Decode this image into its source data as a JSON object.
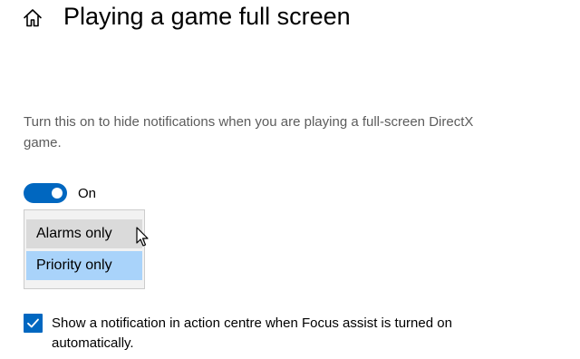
{
  "header": {
    "icon": "home-icon",
    "title": "Playing a game full screen"
  },
  "description": "Turn this on to hide notifications when you are playing a full-screen DirectX game.",
  "toggle": {
    "state": "on",
    "label": "On",
    "accent_color": "#0067c0"
  },
  "dropdown": {
    "options": [
      {
        "label": "Alarms only",
        "state": "hovered"
      },
      {
        "label": "Priority only",
        "state": "selected"
      }
    ],
    "selected_color": "#a9d3fa",
    "hover_color": "#dadada"
  },
  "checkbox": {
    "checked": true,
    "label": "Show a notification in action centre when Focus assist is turned on automatically."
  },
  "pointer": "arrow-cursor-icon"
}
